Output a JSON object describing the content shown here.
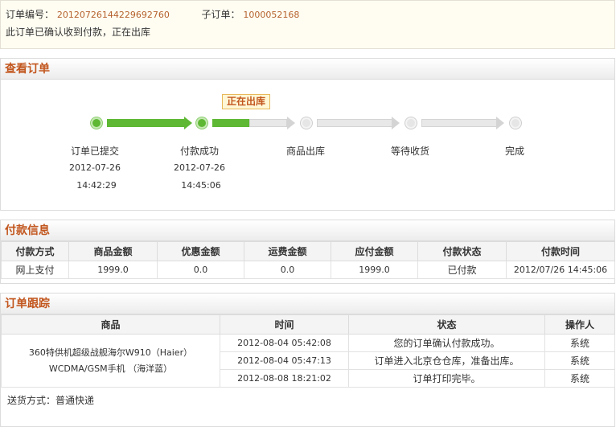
{
  "order": {
    "number_label": "订单编号：",
    "number": "20120726144229692760",
    "sub_label": "子订单：",
    "sub_number": "1000052168",
    "status_message": "此订单已确认收到付款，正在出库"
  },
  "view": {
    "title": "查看订单",
    "current_tag": "正在出库",
    "steps": [
      {
        "label": "订单已提交",
        "date": "2012-07-26",
        "time": "14:42:29",
        "state": "done"
      },
      {
        "label": "付款成功",
        "date": "2012-07-26",
        "time": "14:45:06",
        "state": "done"
      },
      {
        "label": "商品出库",
        "date": "",
        "time": "",
        "state": "current"
      },
      {
        "label": "等待收货",
        "date": "",
        "time": "",
        "state": "todo"
      },
      {
        "label": "完成",
        "date": "",
        "time": "",
        "state": "todo"
      }
    ]
  },
  "payment": {
    "title": "付款信息",
    "headers": [
      "付款方式",
      "商品金额",
      "优惠金额",
      "运费金额",
      "应付金额",
      "付款状态",
      "付款时间"
    ],
    "row": [
      "网上支付",
      "1999.0",
      "0.0",
      "0.0",
      "1999.0",
      "已付款",
      "2012/07/26 14:45:06"
    ]
  },
  "tracking": {
    "title": "订单跟踪",
    "headers": [
      "商品",
      "时间",
      "状态",
      "操作人"
    ],
    "product": "360特供机超级战舰海尔W910（Haier）WCDMA/GSM手机 （海洋蓝）",
    "rows": [
      {
        "time": "2012-08-04 05:42:08",
        "status": "您的订单确认付款成功。",
        "operator": "系统"
      },
      {
        "time": "2012-08-04 05:47:13",
        "status": "订单进入北京仓仓库，准备出库。",
        "operator": "系统"
      },
      {
        "time": "2012-08-08 18:21:02",
        "status": "订单打印完毕。",
        "operator": "系统"
      }
    ],
    "shipping": "送货方式：普通快递"
  },
  "colors": {
    "accent": "#c2561e",
    "progress_done": "#5eb834",
    "progress_todo": "#e6e6e6"
  }
}
